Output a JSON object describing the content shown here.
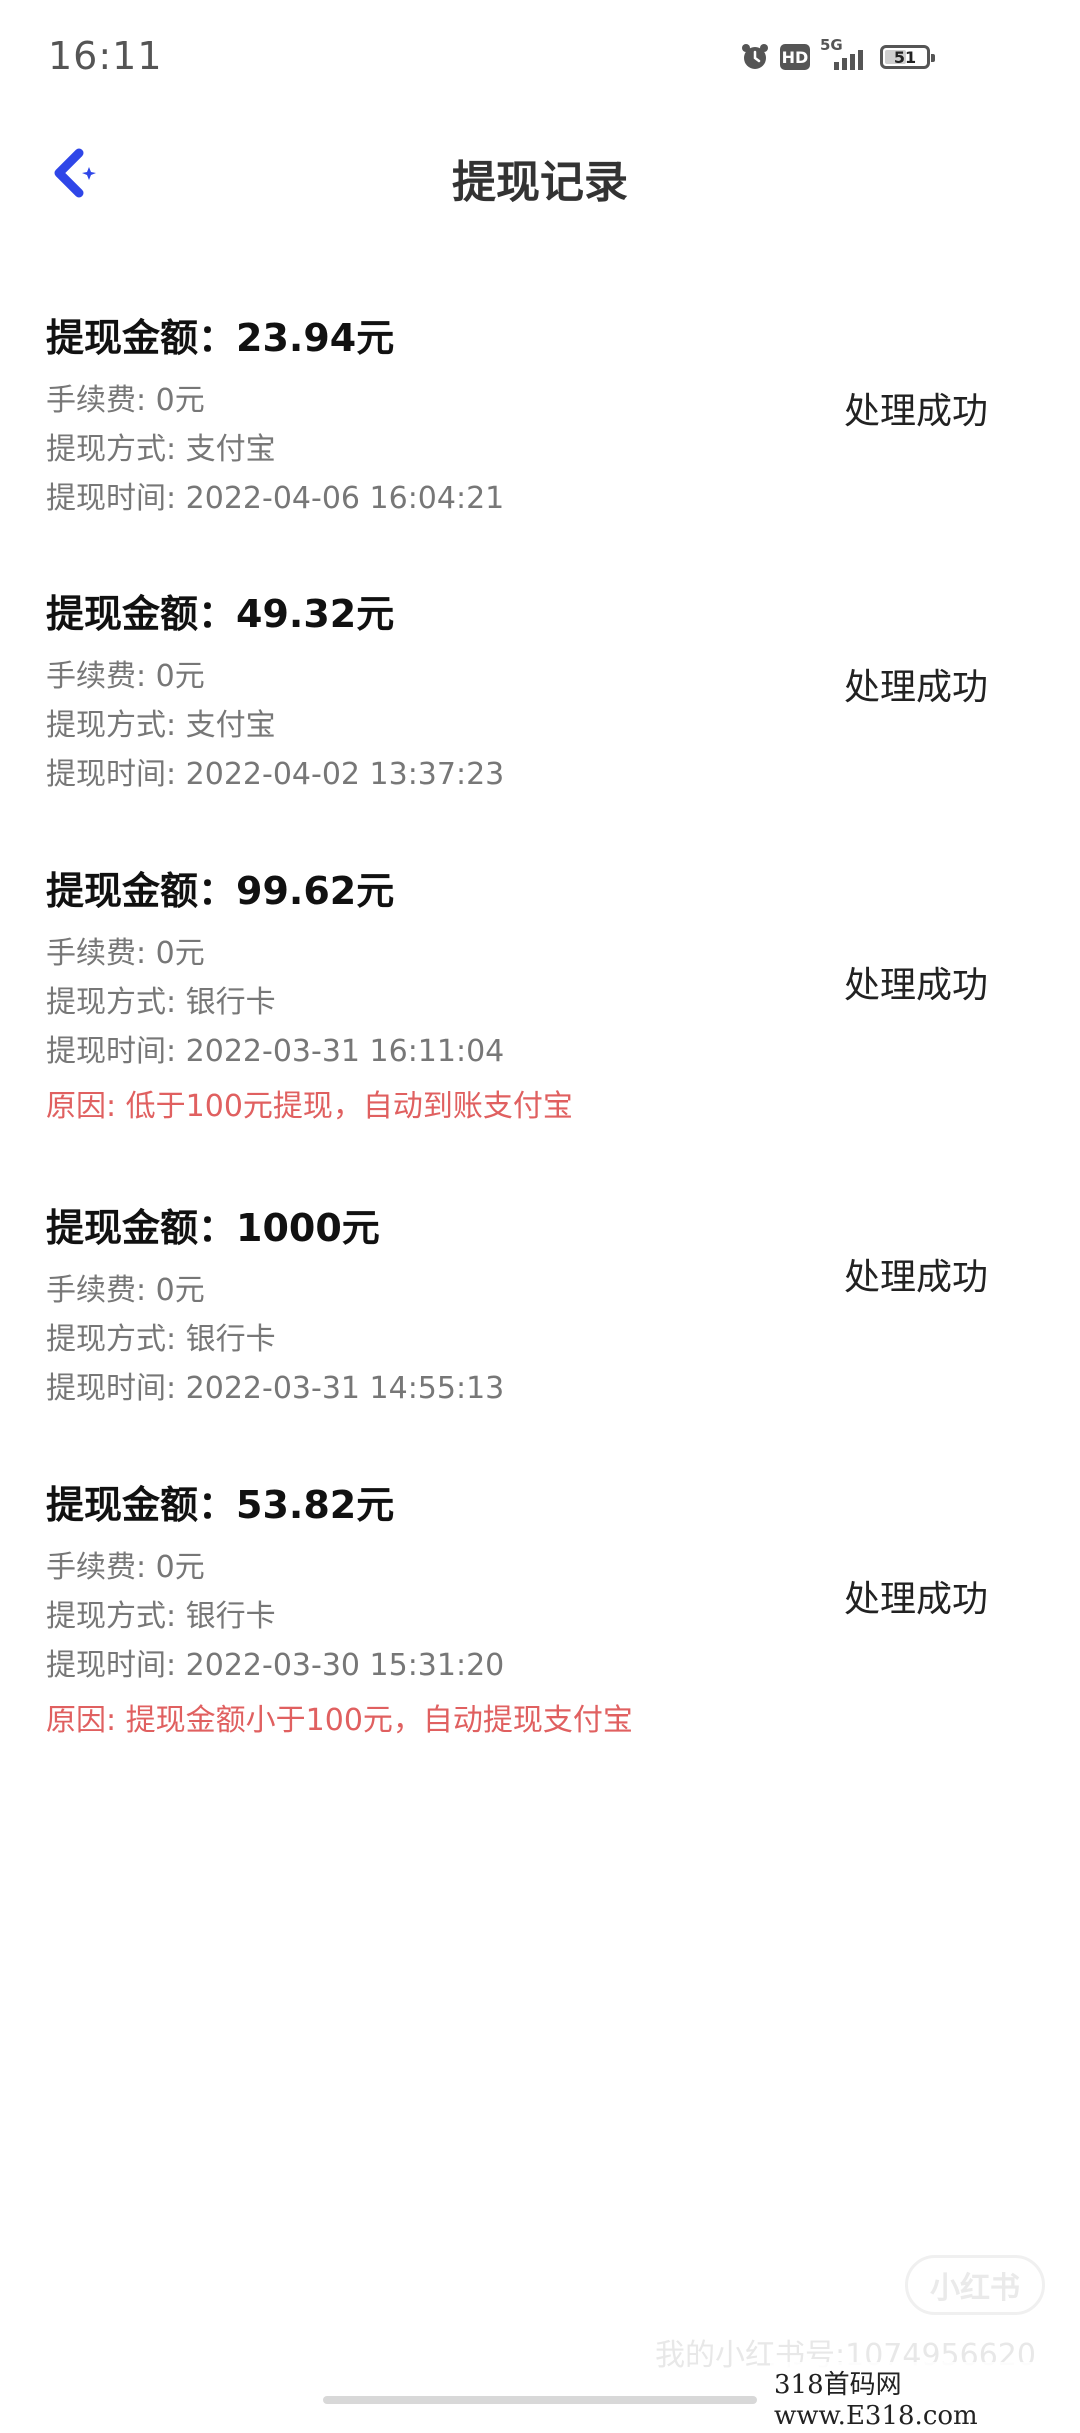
{
  "status_bar": {
    "time": "16:11",
    "hd_label": "HD",
    "network_label": "5G",
    "battery_level": "51",
    "battery_percent": 51
  },
  "header": {
    "title": "提现记录",
    "accent_color": "#2f46e8"
  },
  "records": [
    {
      "amount": "提现金额：23.94元",
      "fee": "手续费: 0元",
      "method": "提现方式: 支付宝",
      "time": "提现时间: 2022-04-06 16:04:21",
      "reason": "",
      "status": "处理成功"
    },
    {
      "amount": "提现金额：49.32元",
      "fee": "手续费: 0元",
      "method": "提现方式: 支付宝",
      "time": "提现时间: 2022-04-02 13:37:23",
      "reason": "",
      "status": "处理成功"
    },
    {
      "amount": "提现金额：99.62元",
      "fee": "手续费: 0元",
      "method": "提现方式: 银行卡",
      "time": "提现时间: 2022-03-31 16:11:04",
      "reason": "原因: 低于100元提现，自动到账支付宝",
      "status": "处理成功"
    },
    {
      "amount": "提现金额：1000元",
      "fee": "手续费: 0元",
      "method": "提现方式: 银行卡",
      "time": "提现时间: 2022-03-31 14:55:13",
      "reason": "",
      "status": "处理成功"
    },
    {
      "amount": "提现金额：53.82元",
      "fee": "手续费: 0元",
      "method": "提现方式: 银行卡",
      "time": "提现时间: 2022-03-30 15:31:20",
      "reason": "原因: 提现金额小于100元，自动提现支付宝",
      "status": "处理成功"
    }
  ],
  "watermarks": {
    "logo": "小红书",
    "user": "我的小红书号:1074956620",
    "site": "318首码网 www.E318.com"
  }
}
